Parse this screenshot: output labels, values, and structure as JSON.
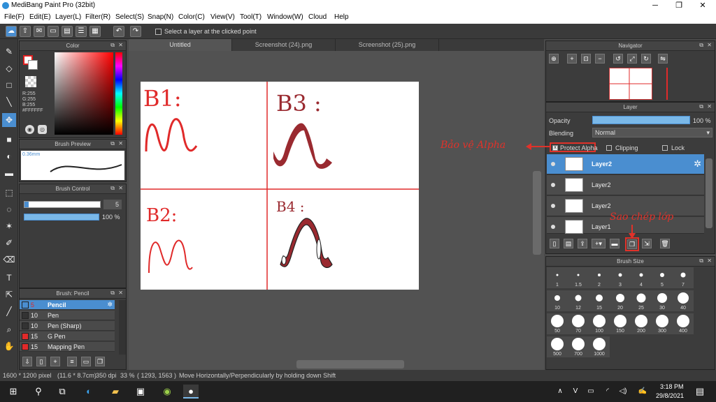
{
  "app": {
    "title": "MediBang Paint Pro (32bit)"
  },
  "window_controls": {
    "minimize": "─",
    "maximize": "❐",
    "close": "✕"
  },
  "menu": [
    "File(F)",
    "Edit(E)",
    "Layer(L)",
    "Filter(R)",
    "Select(S)",
    "Snap(N)",
    "Color(C)",
    "View(V)",
    "Tool(T)",
    "Window(W)",
    "Cloud",
    "Help"
  ],
  "toolbar": {
    "select_layer_label": "Select a layer at the clicked point"
  },
  "tabs": [
    "Untitled",
    "Screenshot (24).png",
    "Screenshot (25).png"
  ],
  "color_panel": {
    "title": "Color",
    "r": "R:255",
    "g": "G:255",
    "b": "B:255",
    "hex": "#FFFFFF"
  },
  "brush_preview": {
    "title": "Brush Preview",
    "size": "0.36mm"
  },
  "brush_control": {
    "title": "Brush Control",
    "size_value": "5",
    "opacity_value": "100 %"
  },
  "brush_list": {
    "title": "Brush: Pencil",
    "items": [
      {
        "size": "5",
        "name": "Pencil",
        "color": "#4a8ed0",
        "selected": true
      },
      {
        "size": "10",
        "name": "Pen",
        "color": "#333333",
        "selected": false
      },
      {
        "size": "10",
        "name": "Pen (Sharp)",
        "color": "#333333",
        "selected": false
      },
      {
        "size": "15",
        "name": "G Pen",
        "color": "#e02a2a",
        "selected": false
      },
      {
        "size": "15",
        "name": "Mapping Pen",
        "color": "#e02a2a",
        "selected": false
      }
    ]
  },
  "canvas": {
    "labels": {
      "b1": "B1:",
      "b2": "B2:",
      "b3": "B3 :",
      "b4": "B4 :"
    }
  },
  "navigator": {
    "title": "Navigator"
  },
  "layer_panel": {
    "title": "Layer",
    "opacity_label": "Opacity",
    "opacity_value": "100 %",
    "blending_label": "Blending",
    "blending_value": "Normal",
    "protect_alpha": "Protect Alpha",
    "clipping": "Clipping",
    "lock": "Lock",
    "layers": [
      {
        "name": "Layer2",
        "selected": true
      },
      {
        "name": "Layer2",
        "selected": false
      },
      {
        "name": "Layer2",
        "selected": false
      },
      {
        "name": "Layer1",
        "selected": false
      }
    ]
  },
  "annotations": {
    "protect_alpha_note": "Bảo vệ Alpha",
    "copy_layer_note": "Sao chép lớp"
  },
  "brush_size": {
    "title": "Brush Size",
    "sizes": [
      "1",
      "1.5",
      "2",
      "3",
      "4",
      "5",
      "7",
      "10",
      "12",
      "15",
      "20",
      "25",
      "30",
      "40",
      "50",
      "70",
      "100",
      "150",
      "200",
      "300",
      "400",
      "500",
      "700",
      "1000"
    ]
  },
  "status": {
    "dimensions": "1600 * 1200 pixel",
    "physical": "(11.6 * 8.7cm)",
    "dpi": "350 dpi",
    "zoom": "33 %",
    "coords": "( 1293, 1563 )",
    "hint": "Move Horizontally/Perpendicularly by holding down Shift"
  },
  "taskbar": {
    "time": "3:18 PM",
    "date": "29/8/2021"
  },
  "colors": {
    "accent": "#4a8ed0",
    "annotation_red": "#e0322a"
  }
}
